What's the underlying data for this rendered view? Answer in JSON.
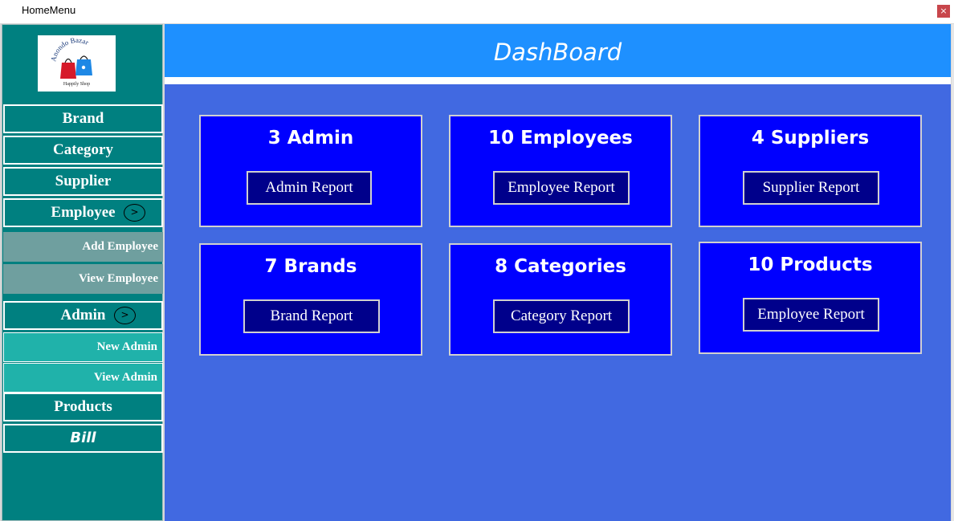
{
  "window": {
    "title": "HomeMenu",
    "close_label": "×"
  },
  "logo": {
    "brand_name": "Anondo Bazar",
    "tagline": "Happily Shop"
  },
  "sidebar": {
    "brand": "Brand",
    "category": "Category",
    "supplier": "Supplier",
    "employee": "Employee",
    "employee_expand": ">",
    "add_employee": "Add Employee",
    "view_employee": "View Employee",
    "admin": "Admin",
    "admin_expand": ">",
    "new_admin": "New Admin",
    "view_admin": "View Admin",
    "products": "Products",
    "bill": "Bill"
  },
  "header": {
    "title": "DashBoard"
  },
  "cards": [
    {
      "title": "3 Admin",
      "button": "Admin Report"
    },
    {
      "title": "10 Employees",
      "button": "Employee Report"
    },
    {
      "title": "4 Suppliers",
      "button": "Supplier Report"
    },
    {
      "title": "7 Brands",
      "button": "Brand Report"
    },
    {
      "title": "8 Categories",
      "button": "Category Report"
    },
    {
      "title": "10 Products",
      "button": "Employee Report"
    }
  ],
  "colors": {
    "sidebar_bg": "#008080",
    "submenu_gray": "#6f9f9f",
    "submenu_teal": "#20b2aa",
    "main_bg": "#4169e1",
    "header_bg": "#1e90ff",
    "card_bg": "#0000ff",
    "card_button_bg": "#00008b"
  }
}
